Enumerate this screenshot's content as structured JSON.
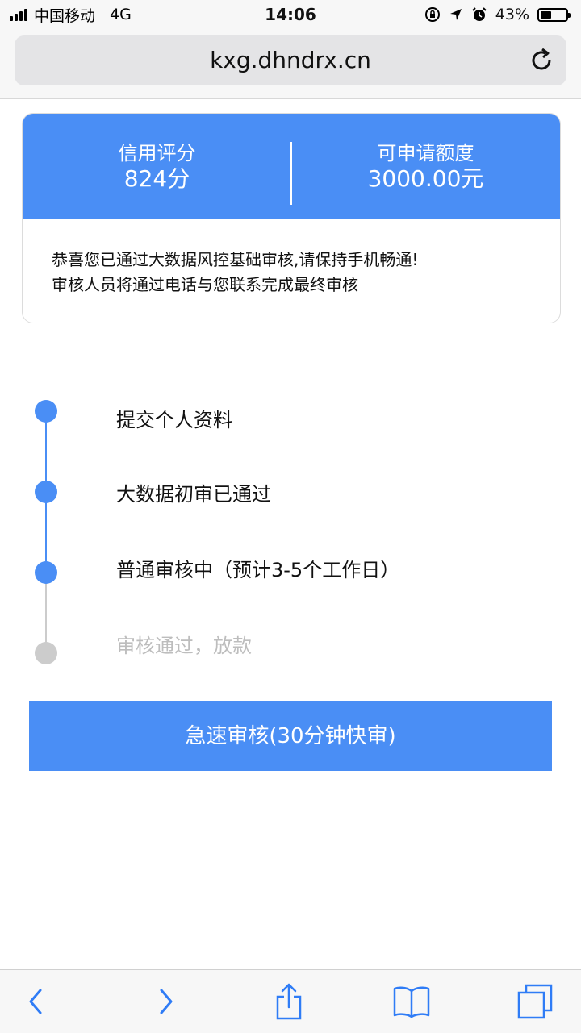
{
  "status_bar": {
    "carrier": "中国移动",
    "network": "4G",
    "time": "14:06",
    "battery_percent_text": "43%",
    "battery_level": 0.43,
    "icons": [
      "signal-icon",
      "orientation-lock-icon",
      "location-icon",
      "alarm-icon",
      "battery-icon"
    ]
  },
  "browser": {
    "url": "kxg.dhndrx.cn",
    "icons": {
      "reload": "reload-icon",
      "back": "chevron-left-icon",
      "forward": "chevron-right-icon",
      "share": "share-icon",
      "bookmarks": "book-icon",
      "tabs": "tabs-icon"
    }
  },
  "score_card": {
    "credit_label": "信用评分",
    "credit_value": "824分",
    "limit_label": "可申请额度",
    "limit_value": "3000.00元",
    "message_line1": "恭喜您已通过大数据风控基础审核,请保持手机畅通!",
    "message_line2": "审核人员将通过电话与您联系完成最终审核"
  },
  "timeline": {
    "steps": [
      {
        "label": "提交个人资料",
        "status": "done"
      },
      {
        "label": "大数据初审已通过",
        "status": "done"
      },
      {
        "label": "普通审核中（预计3-5个工作日）",
        "status": "done"
      },
      {
        "label": "审核通过，放款",
        "status": "pending"
      }
    ]
  },
  "cta": {
    "label": "急速审核(30分钟快审)"
  },
  "colors": {
    "accent": "#4a8ef5",
    "pending": "#cccccc",
    "pending_text": "#bdbdbd"
  }
}
